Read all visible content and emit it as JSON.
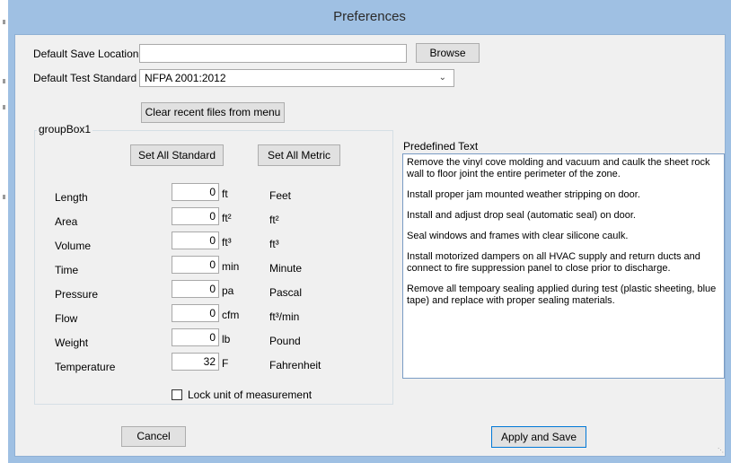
{
  "window": {
    "title": "Preferences"
  },
  "save_location": {
    "label": "Default Save Location:",
    "value": "",
    "browse_label": "Browse"
  },
  "test_standard": {
    "label": "Default Test Standard",
    "value": "NFPA 2001:2012"
  },
  "clear_recent_label": "Clear recent files from menu",
  "group_box": {
    "title": "groupBox1",
    "set_standard_label": "Set All Standard",
    "set_metric_label": "Set All Metric",
    "rows": [
      {
        "name": "Length",
        "value": "0",
        "unit": "ft",
        "unit_name": "Feet"
      },
      {
        "name": "Area",
        "value": "0",
        "unit": "ft²",
        "unit_name": "ft²"
      },
      {
        "name": "Volume",
        "value": "0",
        "unit": "ft³",
        "unit_name": "ft³"
      },
      {
        "name": "Time",
        "value": "0",
        "unit": "min",
        "unit_name": "Minute"
      },
      {
        "name": "Pressure",
        "value": "0",
        "unit": "pa",
        "unit_name": "Pascal"
      },
      {
        "name": "Flow",
        "value": "0",
        "unit": "cfm",
        "unit_name": "ft³/min"
      },
      {
        "name": "Weight",
        "value": "0",
        "unit": "lb",
        "unit_name": "Pound"
      },
      {
        "name": "Temperature",
        "value": "32",
        "unit": "F",
        "unit_name": "Fahrenheit"
      }
    ],
    "lock_label": "Lock unit of measurement",
    "lock_checked": false
  },
  "predefined": {
    "label": "Predefined Text",
    "paragraphs": [
      "Remove the vinyl cove molding and vacuum and caulk the sheet rock wall to floor joint the entire perimeter of the zone.",
      "Install proper jam mounted weather stripping on door.",
      "Install and adjust drop seal (automatic seal) on door.",
      "Seal windows and frames with clear silicone caulk.",
      "Install motorized dampers on all HVAC supply and return ducts and connect to fire suppression panel to close prior to discharge.",
      "Remove all tempoary sealing applied during test (plastic sheeting, blue tape) and replace with proper sealing materials."
    ]
  },
  "footer": {
    "cancel_label": "Cancel",
    "apply_label": "Apply and Save"
  }
}
